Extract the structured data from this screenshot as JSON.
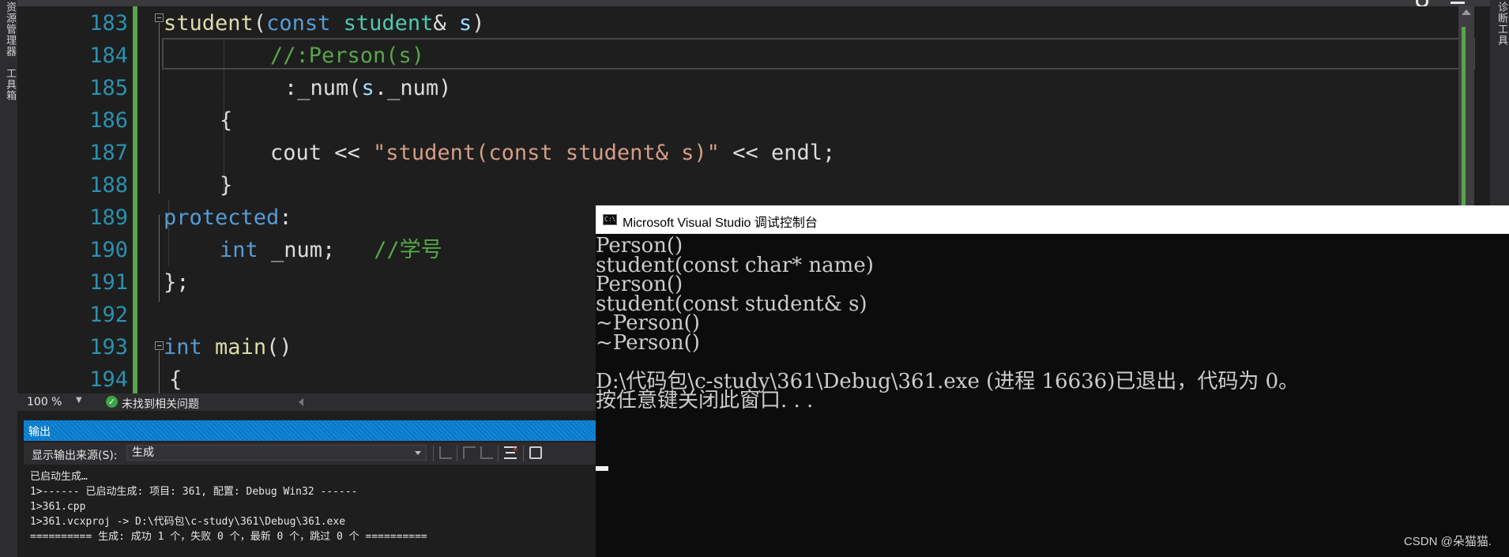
{
  "left_strip": {
    "tab1": "资源管理器",
    "tab2": "工具箱"
  },
  "right_strip": {
    "tab1": "诊断工具"
  },
  "editor": {
    "lines": [
      {
        "num": "183",
        "tokens": [
          {
            "c": "fn",
            "t": "student"
          },
          {
            "c": "id",
            "t": "("
          },
          {
            "c": "kw",
            "t": "const"
          },
          {
            "c": "id",
            "t": " "
          },
          {
            "c": "ty",
            "t": "student"
          },
          {
            "c": "id",
            "t": "& "
          },
          {
            "c": "pm",
            "t": "s"
          },
          {
            "c": "id",
            "t": ")"
          }
        ]
      },
      {
        "num": "184",
        "tokens": [
          {
            "c": "cm",
            "t": "//:Person(s)"
          }
        ]
      },
      {
        "num": "185",
        "tokens": [
          {
            "c": "id",
            "t": ":_num("
          },
          {
            "c": "pm",
            "t": "s"
          },
          {
            "c": "id",
            "t": "._num)"
          }
        ]
      },
      {
        "num": "186",
        "tokens": [
          {
            "c": "id",
            "t": "{"
          }
        ]
      },
      {
        "num": "187",
        "tokens": [
          {
            "c": "id",
            "t": "cout << "
          },
          {
            "c": "str",
            "t": "\"student(const student& s)\""
          },
          {
            "c": "id",
            "t": " << endl;"
          }
        ]
      },
      {
        "num": "188",
        "tokens": [
          {
            "c": "id",
            "t": "}"
          }
        ]
      },
      {
        "num": "189",
        "tokens": [
          {
            "c": "kw",
            "t": "protected"
          },
          {
            "c": "id",
            "t": ":"
          }
        ]
      },
      {
        "num": "190",
        "tokens": [
          {
            "c": "kw",
            "t": "int"
          },
          {
            "c": "id",
            "t": " _num;   "
          },
          {
            "c": "cm",
            "t": "//学号"
          }
        ]
      },
      {
        "num": "191",
        "tokens": [
          {
            "c": "id",
            "t": "};"
          }
        ]
      },
      {
        "num": "192",
        "tokens": []
      },
      {
        "num": "193",
        "tokens": [
          {
            "c": "kw",
            "t": "int"
          },
          {
            "c": "id",
            "t": " "
          },
          {
            "c": "fn",
            "t": "main"
          },
          {
            "c": "id",
            "t": "()"
          }
        ]
      },
      {
        "num": "194",
        "tokens": [
          {
            "c": "id",
            "t": "{"
          }
        ]
      }
    ]
  },
  "status": {
    "zoom": "100 %",
    "issues": "未找到相关问题"
  },
  "output": {
    "title": "输出",
    "source_label": "显示输出来源(S):",
    "source_value": "生成",
    "lines": [
      "已启动生成…",
      "1>------ 已启动生成: 项目: 361, 配置: Debug Win32 ------",
      "1>361.cpp",
      "1>361.vcxproj -> D:\\代码包\\c-study\\361\\Debug\\361.exe",
      "========== 生成: 成功 1 个，失败 0 个，最新 0 个，跳过 0 个 =========="
    ]
  },
  "console": {
    "title": "Microsoft Visual Studio 调试控制台",
    "icon_text": "C:\\",
    "lines": [
      "Person()",
      "student(const char* name)",
      "Person()",
      "student(const student& s)",
      "~Person()",
      "~Person()",
      "",
      "D:\\代码包\\c-study\\361\\Debug\\361.exe (进程 16636)已退出，代码为 0。",
      "按任意键关闭此窗口. . ."
    ]
  },
  "watermark": "CSDN @朵猫猫."
}
